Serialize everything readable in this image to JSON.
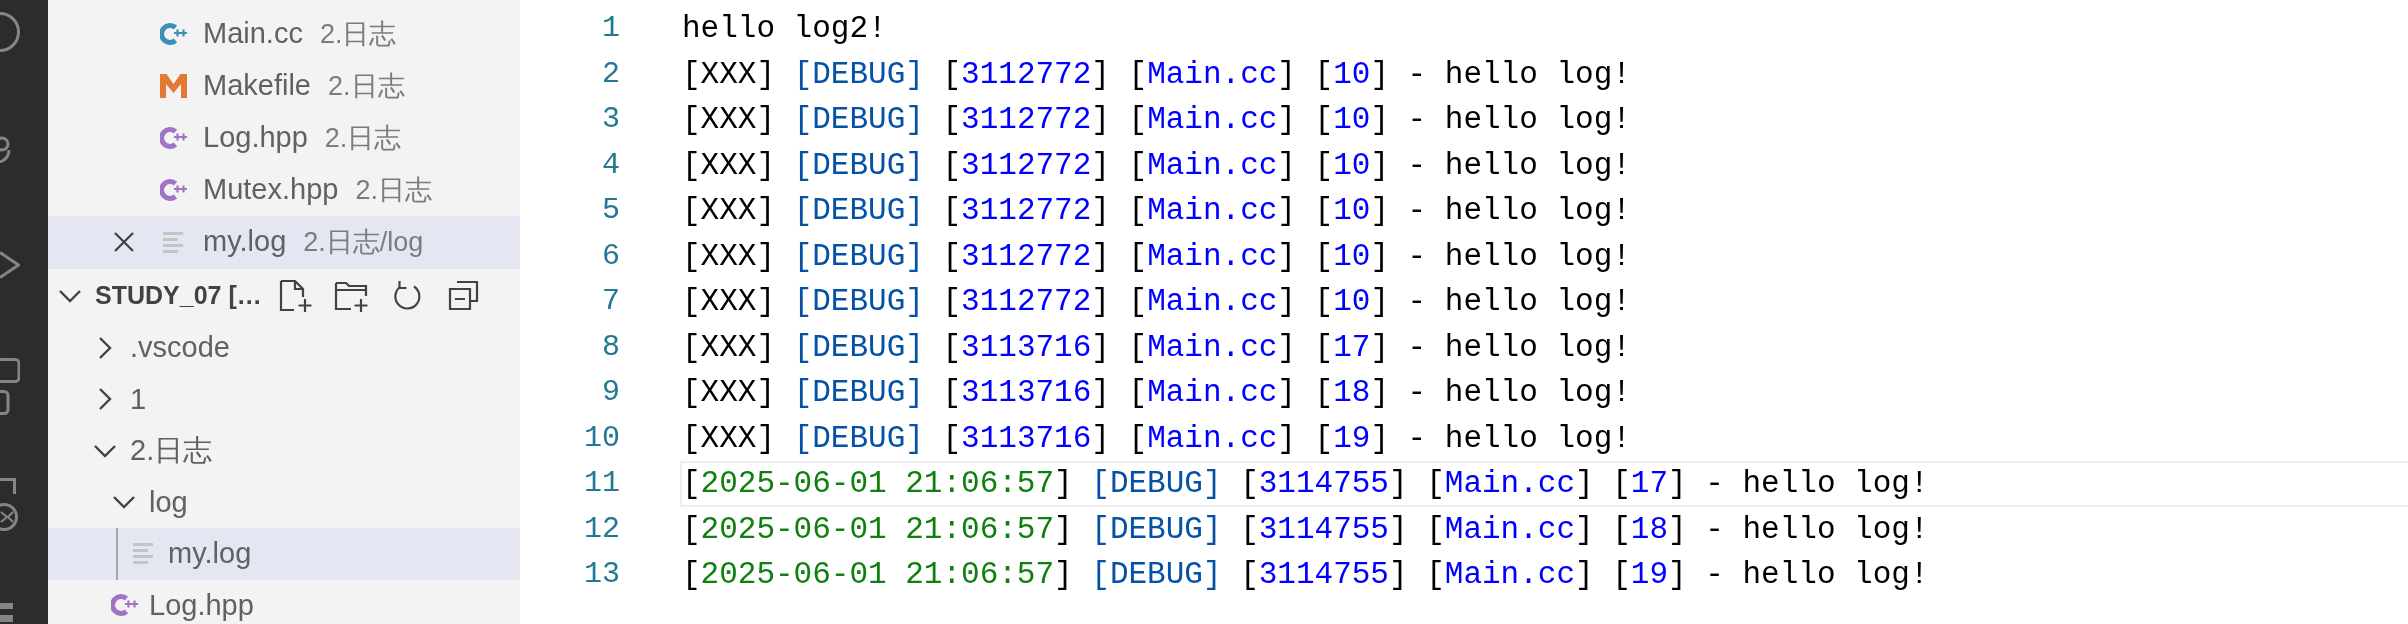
{
  "open_editors": [
    {
      "name": "Main.cc",
      "description": "2.日志",
      "kind": "cc",
      "selected": false
    },
    {
      "name": "Makefile",
      "description": "2.日志",
      "kind": "makefile",
      "selected": false
    },
    {
      "name": "Log.hpp",
      "description": "2.日志",
      "kind": "hpp",
      "selected": false
    },
    {
      "name": "Mutex.hpp",
      "description": "2.日志",
      "kind": "hpp",
      "selected": false
    },
    {
      "name": "my.log",
      "description": "2.日志/log",
      "kind": "log",
      "selected": true
    }
  ],
  "explorer": {
    "title": "STUDY_07 […",
    "expanded": true,
    "tree": [
      {
        "label": ".vscode",
        "kind": "folder",
        "expanded": false,
        "selected": false
      },
      {
        "label": "1",
        "kind": "folder",
        "expanded": false,
        "selected": false
      },
      {
        "label": "2.日志",
        "kind": "folder",
        "expanded": true,
        "selected": false,
        "children": [
          {
            "label": "log",
            "kind": "folder",
            "expanded": true,
            "selected": false,
            "children": [
              {
                "label": "my.log",
                "kind": "log",
                "selected": true
              }
            ]
          },
          {
            "label": "Log.hpp",
            "kind": "hpp",
            "selected": false
          }
        ]
      }
    ]
  },
  "editor": {
    "lines": [
      {
        "number": "1",
        "current": false,
        "tokens": [
          {
            "kind": "plain",
            "text": "hello log2!"
          }
        ]
      },
      {
        "number": "2",
        "current": false,
        "tokens": [
          {
            "kind": "plain",
            "text": "[XXX] "
          },
          {
            "kind": "level",
            "text": "[DEBUG]"
          },
          {
            "kind": "plain",
            "text": " ["
          },
          {
            "kind": "constant",
            "text": "3112772"
          },
          {
            "kind": "plain",
            "text": "] ["
          },
          {
            "kind": "constant",
            "text": "Main.cc"
          },
          {
            "kind": "plain",
            "text": "] ["
          },
          {
            "kind": "constant",
            "text": "10"
          },
          {
            "kind": "plain",
            "text": "] - hello log!"
          }
        ]
      },
      {
        "number": "3",
        "current": false,
        "tokens": [
          {
            "kind": "plain",
            "text": "[XXX] "
          },
          {
            "kind": "level",
            "text": "[DEBUG]"
          },
          {
            "kind": "plain",
            "text": " ["
          },
          {
            "kind": "constant",
            "text": "3112772"
          },
          {
            "kind": "plain",
            "text": "] ["
          },
          {
            "kind": "constant",
            "text": "Main.cc"
          },
          {
            "kind": "plain",
            "text": "] ["
          },
          {
            "kind": "constant",
            "text": "10"
          },
          {
            "kind": "plain",
            "text": "] - hello log!"
          }
        ]
      },
      {
        "number": "4",
        "current": false,
        "tokens": [
          {
            "kind": "plain",
            "text": "[XXX] "
          },
          {
            "kind": "level",
            "text": "[DEBUG]"
          },
          {
            "kind": "plain",
            "text": " ["
          },
          {
            "kind": "constant",
            "text": "3112772"
          },
          {
            "kind": "plain",
            "text": "] ["
          },
          {
            "kind": "constant",
            "text": "Main.cc"
          },
          {
            "kind": "plain",
            "text": "] ["
          },
          {
            "kind": "constant",
            "text": "10"
          },
          {
            "kind": "plain",
            "text": "] - hello log!"
          }
        ]
      },
      {
        "number": "5",
        "current": false,
        "tokens": [
          {
            "kind": "plain",
            "text": "[XXX] "
          },
          {
            "kind": "level",
            "text": "[DEBUG]"
          },
          {
            "kind": "plain",
            "text": " ["
          },
          {
            "kind": "constant",
            "text": "3112772"
          },
          {
            "kind": "plain",
            "text": "] ["
          },
          {
            "kind": "constant",
            "text": "Main.cc"
          },
          {
            "kind": "plain",
            "text": "] ["
          },
          {
            "kind": "constant",
            "text": "10"
          },
          {
            "kind": "plain",
            "text": "] - hello log!"
          }
        ]
      },
      {
        "number": "6",
        "current": false,
        "tokens": [
          {
            "kind": "plain",
            "text": "[XXX] "
          },
          {
            "kind": "level",
            "text": "[DEBUG]"
          },
          {
            "kind": "plain",
            "text": " ["
          },
          {
            "kind": "constant",
            "text": "3112772"
          },
          {
            "kind": "plain",
            "text": "] ["
          },
          {
            "kind": "constant",
            "text": "Main.cc"
          },
          {
            "kind": "plain",
            "text": "] ["
          },
          {
            "kind": "constant",
            "text": "10"
          },
          {
            "kind": "plain",
            "text": "] - hello log!"
          }
        ]
      },
      {
        "number": "7",
        "current": false,
        "tokens": [
          {
            "kind": "plain",
            "text": "[XXX] "
          },
          {
            "kind": "level",
            "text": "[DEBUG]"
          },
          {
            "kind": "plain",
            "text": " ["
          },
          {
            "kind": "constant",
            "text": "3112772"
          },
          {
            "kind": "plain",
            "text": "] ["
          },
          {
            "kind": "constant",
            "text": "Main.cc"
          },
          {
            "kind": "plain",
            "text": "] ["
          },
          {
            "kind": "constant",
            "text": "10"
          },
          {
            "kind": "plain",
            "text": "] - hello log!"
          }
        ]
      },
      {
        "number": "8",
        "current": false,
        "tokens": [
          {
            "kind": "plain",
            "text": "[XXX] "
          },
          {
            "kind": "level",
            "text": "[DEBUG]"
          },
          {
            "kind": "plain",
            "text": " ["
          },
          {
            "kind": "constant",
            "text": "3113716"
          },
          {
            "kind": "plain",
            "text": "] ["
          },
          {
            "kind": "constant",
            "text": "Main.cc"
          },
          {
            "kind": "plain",
            "text": "] ["
          },
          {
            "kind": "constant",
            "text": "17"
          },
          {
            "kind": "plain",
            "text": "] - hello log!"
          }
        ]
      },
      {
        "number": "9",
        "current": false,
        "tokens": [
          {
            "kind": "plain",
            "text": "[XXX] "
          },
          {
            "kind": "level",
            "text": "[DEBUG]"
          },
          {
            "kind": "plain",
            "text": " ["
          },
          {
            "kind": "constant",
            "text": "3113716"
          },
          {
            "kind": "plain",
            "text": "] ["
          },
          {
            "kind": "constant",
            "text": "Main.cc"
          },
          {
            "kind": "plain",
            "text": "] ["
          },
          {
            "kind": "constant",
            "text": "18"
          },
          {
            "kind": "plain",
            "text": "] - hello log!"
          }
        ]
      },
      {
        "number": "10",
        "current": false,
        "tokens": [
          {
            "kind": "plain",
            "text": "[XXX] "
          },
          {
            "kind": "level",
            "text": "[DEBUG]"
          },
          {
            "kind": "plain",
            "text": " ["
          },
          {
            "kind": "constant",
            "text": "3113716"
          },
          {
            "kind": "plain",
            "text": "] ["
          },
          {
            "kind": "constant",
            "text": "Main.cc"
          },
          {
            "kind": "plain",
            "text": "] ["
          },
          {
            "kind": "constant",
            "text": "19"
          },
          {
            "kind": "plain",
            "text": "] - hello log!"
          }
        ]
      },
      {
        "number": "11",
        "current": true,
        "tokens": [
          {
            "kind": "plain",
            "text": "["
          },
          {
            "kind": "date",
            "text": "2025-06-01 21:06:57"
          },
          {
            "kind": "plain",
            "text": "] "
          },
          {
            "kind": "level",
            "text": "[DEBUG]"
          },
          {
            "kind": "plain",
            "text": " ["
          },
          {
            "kind": "constant",
            "text": "3114755"
          },
          {
            "kind": "plain",
            "text": "] ["
          },
          {
            "kind": "constant",
            "text": "Main.cc"
          },
          {
            "kind": "plain",
            "text": "] ["
          },
          {
            "kind": "constant",
            "text": "17"
          },
          {
            "kind": "plain",
            "text": "] - hello log!"
          }
        ]
      },
      {
        "number": "12",
        "current": false,
        "tokens": [
          {
            "kind": "plain",
            "text": "["
          },
          {
            "kind": "date",
            "text": "2025-06-01 21:06:57"
          },
          {
            "kind": "plain",
            "text": "] "
          },
          {
            "kind": "level",
            "text": "[DEBUG]"
          },
          {
            "kind": "plain",
            "text": " ["
          },
          {
            "kind": "constant",
            "text": "3114755"
          },
          {
            "kind": "plain",
            "text": "] ["
          },
          {
            "kind": "constant",
            "text": "Main.cc"
          },
          {
            "kind": "plain",
            "text": "] ["
          },
          {
            "kind": "constant",
            "text": "18"
          },
          {
            "kind": "plain",
            "text": "] - hello log!"
          }
        ]
      },
      {
        "number": "13",
        "current": false,
        "tokens": [
          {
            "kind": "plain",
            "text": "["
          },
          {
            "kind": "date",
            "text": "2025-06-01 21:06:57"
          },
          {
            "kind": "plain",
            "text": "] "
          },
          {
            "kind": "level",
            "text": "[DEBUG]"
          },
          {
            "kind": "plain",
            "text": " ["
          },
          {
            "kind": "constant",
            "text": "3114755"
          },
          {
            "kind": "plain",
            "text": "] ["
          },
          {
            "kind": "constant",
            "text": "Main.cc"
          },
          {
            "kind": "plain",
            "text": "] ["
          },
          {
            "kind": "constant",
            "text": "19"
          },
          {
            "kind": "plain",
            "text": "] - hello log!"
          }
        ]
      }
    ]
  }
}
